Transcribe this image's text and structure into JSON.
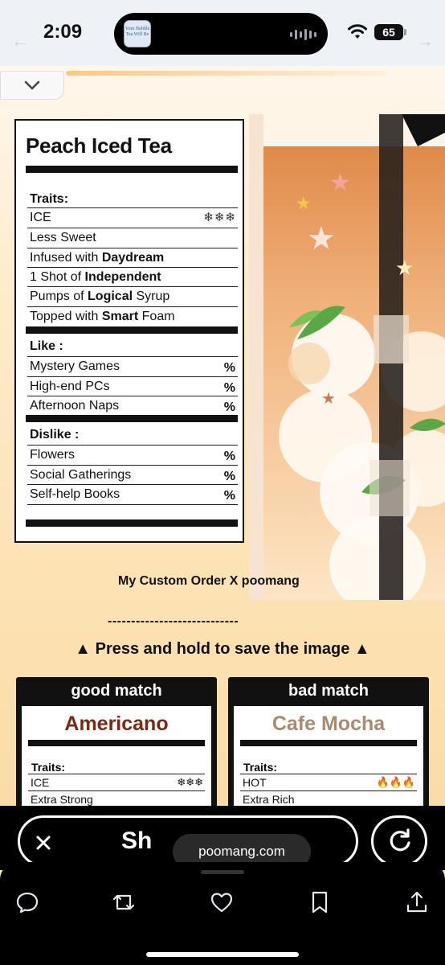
{
  "status": {
    "time": "2:09",
    "battery": "65",
    "island_thumb_text": "Your Bubble Tea Will Be"
  },
  "page": {
    "label": {
      "title": "Peach Iced Tea",
      "traits_heading": "Traits:",
      "traits": [
        {
          "text": "ICE",
          "icons": "❄❄❄"
        },
        {
          "text": "Less Sweet"
        },
        {
          "pre": "Infused with ",
          "bold": "Daydream",
          "post": ""
        },
        {
          "pre": "1 Shot of ",
          "bold": "Independent",
          "post": ""
        },
        {
          "pre": "Pumps of ",
          "bold": "Logical",
          "post": " Syrup"
        },
        {
          "pre": "Topped with ",
          "bold": "Smart",
          "post": " Foam"
        }
      ],
      "like_heading": "Like :",
      "likes": [
        "Mystery Games",
        "High-end PCs",
        "Afternoon Naps"
      ],
      "dislike_heading": "Dislike :",
      "dislikes": [
        "Flowers",
        "Social Gatherings",
        "Self-help Books"
      ],
      "pct": "%"
    },
    "custom_order": "My Custom Order  X poomang",
    "divider": "----------------------------",
    "press_hold": "▲ Press and hold to save the image ▲",
    "good_match": {
      "header": "good match",
      "drink": "Americano",
      "drink_color": "#7a2a12",
      "traits_heading": "Traits:",
      "row1": "ICE",
      "row1_icons": "❄❄❄",
      "row2": "Extra Strong"
    },
    "bad_match": {
      "header": "bad match",
      "drink": "Cafe Mocha",
      "drink_color": "#a88a6e",
      "traits_heading": "Traits:",
      "row1": "HOT",
      "row1_icons": "🔥🔥🔥",
      "row2": "Extra Rich"
    }
  },
  "share_bar": {
    "label": "Sh",
    "url": "poomang.com"
  },
  "toolbar": {
    "icons": [
      "reply-icon",
      "repost-icon",
      "like-icon",
      "bookmark-icon",
      "share-icon"
    ]
  }
}
